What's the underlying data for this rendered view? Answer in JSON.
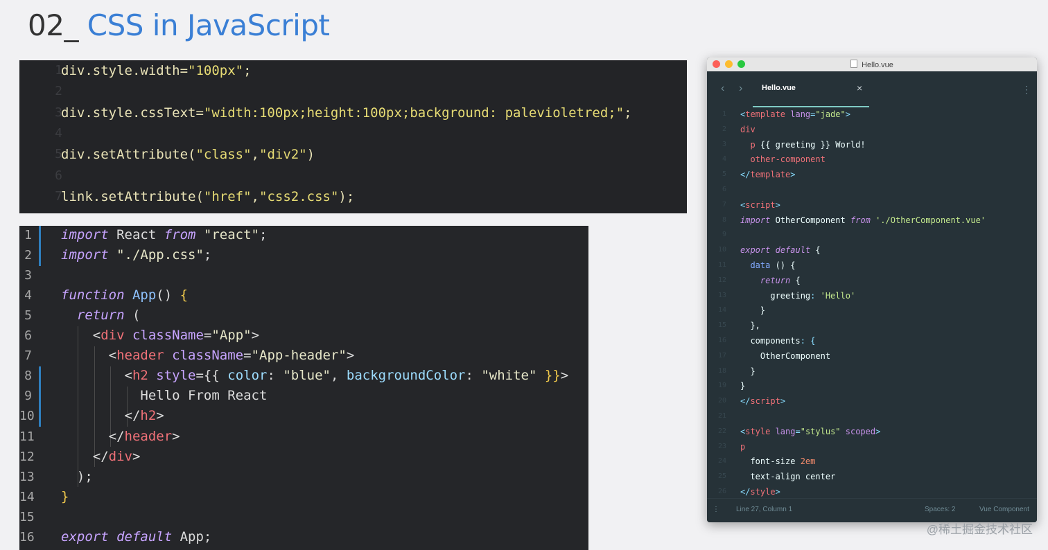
{
  "title": {
    "number": "02_",
    "text": " CSS in JavaScript"
  },
  "colors": {
    "title_text": "#3a7fd5",
    "vue_tab_underline": "#80cbc4",
    "react_gutter_bar": "#2f7fbf"
  },
  "panel1": {
    "lines": [
      {
        "n": "1",
        "tokens": [
          {
            "t": "div",
            "c": "#e8e2b6"
          },
          {
            "t": ".style.width=",
            "c": "#e8e2b6"
          },
          {
            "t": "\"100px\"",
            "c": "#e6db74"
          },
          {
            "t": ";",
            "c": "#e8e2b6"
          }
        ]
      },
      {
        "n": "2",
        "tokens": []
      },
      {
        "n": "3",
        "tokens": [
          {
            "t": "div.style.cssText=",
            "c": "#e8e2b6"
          },
          {
            "t": "\"width:100px;height:100px;background: palevioletred;\"",
            "c": "#e6db74"
          },
          {
            "t": ";",
            "c": "#e8e2b6"
          }
        ]
      },
      {
        "n": "4",
        "tokens": []
      },
      {
        "n": "5",
        "tokens": [
          {
            "t": "div.setAttribute(",
            "c": "#e8e2b6"
          },
          {
            "t": "\"class\"",
            "c": "#e6db74"
          },
          {
            "t": ",",
            "c": "#e8e2b6"
          },
          {
            "t": "\"div2\"",
            "c": "#e6db74"
          },
          {
            "t": ")",
            "c": "#e8e2b6"
          }
        ]
      },
      {
        "n": "6",
        "tokens": []
      },
      {
        "n": "7",
        "tokens": [
          {
            "t": "link.setAttribute(",
            "c": "#e8e2b6"
          },
          {
            "t": "\"href\"",
            "c": "#e6db74"
          },
          {
            "t": ",",
            "c": "#e8e2b6"
          },
          {
            "t": "\"css2.css\"",
            "c": "#e6db74"
          },
          {
            "t": ");",
            "c": "#e8e2b6"
          }
        ]
      }
    ]
  },
  "panel2": {
    "lines": [
      {
        "n": "1",
        "tokens": [
          {
            "t": "import",
            "c": "#c7a4ff",
            "i": true
          },
          {
            "t": " React ",
            "c": "#dcdcdc"
          },
          {
            "t": "from",
            "c": "#c7a4ff",
            "i": true
          },
          {
            "t": " \"react\"",
            "c": "#e6e6c8"
          },
          {
            "t": ";",
            "c": "#dcdcdc"
          }
        ]
      },
      {
        "n": "2",
        "tokens": [
          {
            "t": "import",
            "c": "#c7a4ff",
            "i": true
          },
          {
            "t": " \"./App.css\"",
            "c": "#e6e6c8"
          },
          {
            "t": ";",
            "c": "#dcdcdc"
          }
        ]
      },
      {
        "n": "3",
        "tokens": []
      },
      {
        "n": "4",
        "tokens": [
          {
            "t": "function",
            "c": "#c7a4ff",
            "i": true
          },
          {
            "t": " App",
            "c": "#8fc3ff"
          },
          {
            "t": "() ",
            "c": "#dcdcdc"
          },
          {
            "t": "{",
            "c": "#f0c94c"
          }
        ]
      },
      {
        "n": "5",
        "tokens": [
          {
            "t": "  return",
            "c": "#c7a4ff",
            "i": true
          },
          {
            "t": " (",
            "c": "#dcdcdc"
          }
        ]
      },
      {
        "n": "6",
        "tokens": [
          {
            "t": "    <",
            "c": "#dcdcdc"
          },
          {
            "t": "div",
            "c": "#f07178"
          },
          {
            "t": " className",
            "c": "#c7a4ff"
          },
          {
            "t": "=",
            "c": "#dcdcdc"
          },
          {
            "t": "\"App\"",
            "c": "#e6e6c8"
          },
          {
            "t": ">",
            "c": "#dcdcdc"
          }
        ]
      },
      {
        "n": "7",
        "tokens": [
          {
            "t": "      <",
            "c": "#dcdcdc"
          },
          {
            "t": "header",
            "c": "#f07178"
          },
          {
            "t": " className",
            "c": "#c7a4ff"
          },
          {
            "t": "=",
            "c": "#dcdcdc"
          },
          {
            "t": "\"App-header\"",
            "c": "#e6e6c8"
          },
          {
            "t": ">",
            "c": "#dcdcdc"
          }
        ]
      },
      {
        "n": "8",
        "tokens": [
          {
            "t": "        <",
            "c": "#dcdcdc"
          },
          {
            "t": "h2",
            "c": "#f07178"
          },
          {
            "t": " style",
            "c": "#c7a4ff"
          },
          {
            "t": "={{ ",
            "c": "#dcdcdc"
          },
          {
            "t": "color",
            "c": "#9cdcfe"
          },
          {
            "t": ": ",
            "c": "#dcdcdc"
          },
          {
            "t": "\"blue\"",
            "c": "#e6e6c8"
          },
          {
            "t": ", ",
            "c": "#dcdcdc"
          },
          {
            "t": "backgroundColor",
            "c": "#9cdcfe"
          },
          {
            "t": ": ",
            "c": "#dcdcdc"
          },
          {
            "t": "\"white\"",
            "c": "#e6e6c8"
          },
          {
            "t": " }}",
            "c": "#f0c94c"
          },
          {
            "t": ">",
            "c": "#dcdcdc"
          }
        ]
      },
      {
        "n": "9",
        "tokens": [
          {
            "t": "          Hello From React",
            "c": "#dcdcdc"
          }
        ]
      },
      {
        "n": "10",
        "tokens": [
          {
            "t": "        </",
            "c": "#dcdcdc"
          },
          {
            "t": "h2",
            "c": "#f07178"
          },
          {
            "t": ">",
            "c": "#dcdcdc"
          }
        ]
      },
      {
        "n": "11",
        "tokens": [
          {
            "t": "      </",
            "c": "#dcdcdc"
          },
          {
            "t": "header",
            "c": "#f07178"
          },
          {
            "t": ">",
            "c": "#dcdcdc"
          }
        ]
      },
      {
        "n": "12",
        "tokens": [
          {
            "t": "    </",
            "c": "#dcdcdc"
          },
          {
            "t": "div",
            "c": "#f07178"
          },
          {
            "t": ">",
            "c": "#dcdcdc"
          }
        ]
      },
      {
        "n": "13",
        "tokens": [
          {
            "t": "  );",
            "c": "#dcdcdc"
          }
        ]
      },
      {
        "n": "14",
        "tokens": [
          {
            "t": "}",
            "c": "#f0c94c"
          }
        ]
      },
      {
        "n": "15",
        "tokens": []
      },
      {
        "n": "16",
        "tokens": [
          {
            "t": "export",
            "c": "#c7a4ff",
            "i": true
          },
          {
            "t": " ",
            "c": "#dcdcdc"
          },
          {
            "t": "default",
            "c": "#c7a4ff",
            "i": true
          },
          {
            "t": " App;",
            "c": "#dcdcdc"
          }
        ]
      }
    ]
  },
  "vue_window": {
    "title": "Hello.vue",
    "tab_label": "Hello.vue",
    "tab_close": "×",
    "nav_back": "‹",
    "nav_forward": "›",
    "menu_icon": "⋮",
    "status_menu": "⋮",
    "status_position": "Line 27, Column 1",
    "status_spaces": "Spaces: 2",
    "status_syntax": "Vue Component",
    "lines": [
      {
        "n": "1",
        "tokens": [
          {
            "t": "<",
            "c": "#89ddff"
          },
          {
            "t": "template",
            "c": "#f07178"
          },
          {
            "t": " lang",
            "c": "#c792ea"
          },
          {
            "t": "=",
            "c": "#89ddff"
          },
          {
            "t": "\"jade\"",
            "c": "#c3e88d"
          },
          {
            "t": ">",
            "c": "#89ddff"
          }
        ]
      },
      {
        "n": "2",
        "tokens": [
          {
            "t": "div",
            "c": "#f07178"
          }
        ]
      },
      {
        "n": "3",
        "tokens": [
          {
            "t": "  p",
            "c": "#f07178"
          },
          {
            "t": " {{ greeting }} World!",
            "c": "#eeffff"
          }
        ]
      },
      {
        "n": "4",
        "tokens": [
          {
            "t": "  other-component",
            "c": "#f07178"
          }
        ]
      },
      {
        "n": "5",
        "tokens": [
          {
            "t": "</",
            "c": "#89ddff"
          },
          {
            "t": "template",
            "c": "#f07178"
          },
          {
            "t": ">",
            "c": "#89ddff"
          }
        ]
      },
      {
        "n": "6",
        "tokens": []
      },
      {
        "n": "7",
        "tokens": [
          {
            "t": "<",
            "c": "#89ddff"
          },
          {
            "t": "script",
            "c": "#f07178"
          },
          {
            "t": ">",
            "c": "#89ddff"
          }
        ]
      },
      {
        "n": "8",
        "tokens": [
          {
            "t": "import",
            "c": "#c792ea",
            "i": true
          },
          {
            "t": " OtherComponent ",
            "c": "#eeffff"
          },
          {
            "t": "from",
            "c": "#c792ea",
            "i": true
          },
          {
            "t": " './OtherComponent.vue'",
            "c": "#c3e88d"
          }
        ]
      },
      {
        "n": "9",
        "tokens": []
      },
      {
        "n": "10",
        "tokens": [
          {
            "t": "export",
            "c": "#c792ea",
            "i": true
          },
          {
            "t": " ",
            "c": "#eeffff"
          },
          {
            "t": "default",
            "c": "#c792ea",
            "i": true
          },
          {
            "t": " {",
            "c": "#eeffff"
          }
        ]
      },
      {
        "n": "11",
        "tokens": [
          {
            "t": "  data",
            "c": "#82aaff"
          },
          {
            "t": " () {",
            "c": "#eeffff"
          }
        ]
      },
      {
        "n": "12",
        "tokens": [
          {
            "t": "    return",
            "c": "#c792ea",
            "i": true
          },
          {
            "t": " {",
            "c": "#eeffff"
          }
        ]
      },
      {
        "n": "13",
        "tokens": [
          {
            "t": "      greeting",
            "c": "#eeffff"
          },
          {
            "t": ": ",
            "c": "#89ddff"
          },
          {
            "t": "'Hello'",
            "c": "#c3e88d"
          }
        ]
      },
      {
        "n": "14",
        "tokens": [
          {
            "t": "    }",
            "c": "#eeffff"
          }
        ]
      },
      {
        "n": "15",
        "tokens": [
          {
            "t": "  },",
            "c": "#eeffff"
          }
        ]
      },
      {
        "n": "16",
        "tokens": [
          {
            "t": "  components",
            "c": "#eeffff"
          },
          {
            "t": ": {",
            "c": "#89ddff"
          }
        ]
      },
      {
        "n": "17",
        "tokens": [
          {
            "t": "    OtherComponent",
            "c": "#eeffff"
          }
        ]
      },
      {
        "n": "18",
        "tokens": [
          {
            "t": "  }",
            "c": "#eeffff"
          }
        ]
      },
      {
        "n": "19",
        "tokens": [
          {
            "t": "}",
            "c": "#eeffff"
          }
        ]
      },
      {
        "n": "20",
        "tokens": [
          {
            "t": "</",
            "c": "#89ddff"
          },
          {
            "t": "script",
            "c": "#f07178"
          },
          {
            "t": ">",
            "c": "#89ddff"
          }
        ]
      },
      {
        "n": "21",
        "tokens": []
      },
      {
        "n": "22",
        "tokens": [
          {
            "t": "<",
            "c": "#89ddff"
          },
          {
            "t": "style",
            "c": "#f07178"
          },
          {
            "t": " lang",
            "c": "#c792ea"
          },
          {
            "t": "=",
            "c": "#89ddff"
          },
          {
            "t": "\"stylus\"",
            "c": "#c3e88d"
          },
          {
            "t": " scoped",
            "c": "#c792ea"
          },
          {
            "t": ">",
            "c": "#89ddff"
          }
        ]
      },
      {
        "n": "23",
        "tokens": [
          {
            "t": "p",
            "c": "#f07178"
          }
        ]
      },
      {
        "n": "24",
        "tokens": [
          {
            "t": "  font-size ",
            "c": "#eeffff"
          },
          {
            "t": "2em",
            "c": "#f78c6c"
          }
        ]
      },
      {
        "n": "25",
        "tokens": [
          {
            "t": "  text-align ",
            "c": "#eeffff"
          },
          {
            "t": "center",
            "c": "#eeffff"
          }
        ]
      },
      {
        "n": "26",
        "tokens": [
          {
            "t": "</",
            "c": "#89ddff"
          },
          {
            "t": "style",
            "c": "#f07178"
          },
          {
            "t": ">",
            "c": "#89ddff"
          }
        ]
      }
    ]
  },
  "watermark": "@稀土掘金技术社区"
}
